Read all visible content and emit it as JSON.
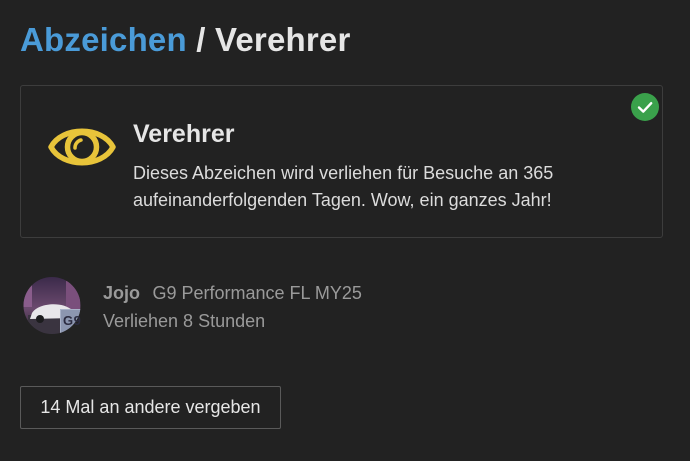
{
  "breadcrumb": {
    "parent": "Abzeichen",
    "separator": "/",
    "current": "Verehrer"
  },
  "badge": {
    "title": "Verehrer",
    "description": "Dieses Abzeichen wird verliehen für Besuche an 365 aufeinanderfolgenden Tagen. Wow, ein ganzes Jahr!",
    "icon": "eye-icon",
    "status_icon": "check-icon"
  },
  "grant": {
    "username": "Jojo",
    "user_title": "G9 Performance FL MY25",
    "granted_text": "Verliehen 8 Stunden",
    "avatar_overlay_text": "G9"
  },
  "other_button": {
    "label": "14 Mal an andere vergeben"
  },
  "colors": {
    "background": "#222222",
    "link": "#4a9bd8",
    "badge_icon": "#e8c43a",
    "check_badge": "#3aa14b"
  }
}
